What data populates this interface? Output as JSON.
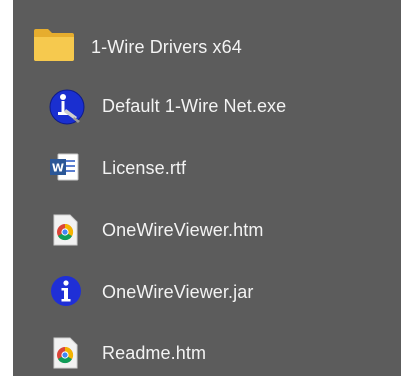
{
  "menu": {
    "items": [
      {
        "label": "1-Wire Drivers x64",
        "icon": "folder-icon"
      },
      {
        "label": "Default 1-Wire Net.exe",
        "icon": "default-net-exe-icon"
      },
      {
        "label": "License.rtf",
        "icon": "word-document-icon"
      },
      {
        "label": "OneWireViewer.htm",
        "icon": "chrome-html-icon"
      },
      {
        "label": "OneWireViewer.jar",
        "icon": "java-info-icon"
      },
      {
        "label": "Readme.htm",
        "icon": "chrome-html-icon"
      }
    ]
  },
  "colors": {
    "background": "#5c5c5c",
    "text": "#f3f3f3",
    "folder": "#f2c34b",
    "info_blue": "#1f2fd6"
  }
}
